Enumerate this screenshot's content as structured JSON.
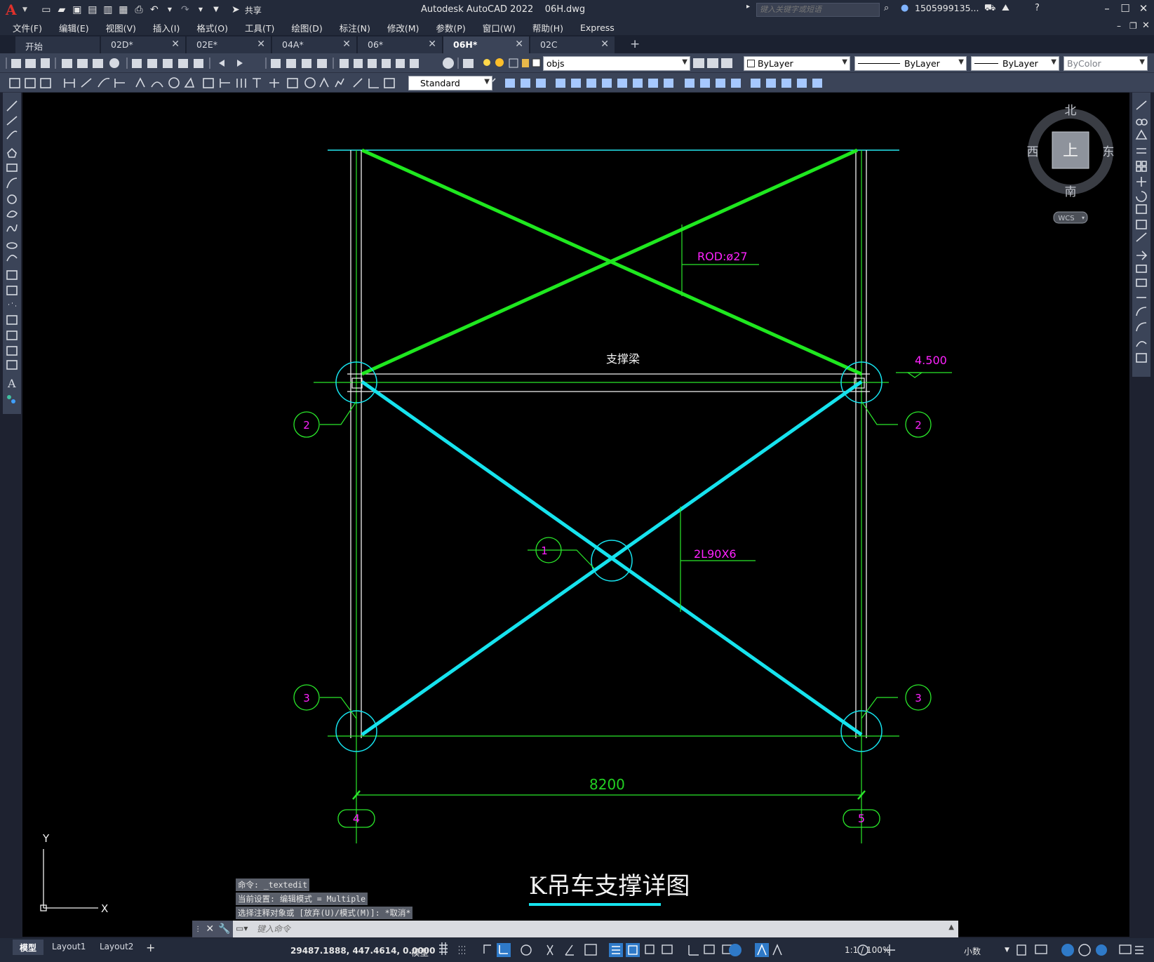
{
  "window": {
    "app_title": "Autodesk AutoCAD 2022",
    "file_name": "06H.dwg",
    "search_placeholder": "键入关键字或短语",
    "user": "1505999135...",
    "share_label": "共享"
  },
  "menu": [
    "文件(F)",
    "编辑(E)",
    "视图(V)",
    "插入(I)",
    "格式(O)",
    "工具(T)",
    "绘图(D)",
    "标注(N)",
    "修改(M)",
    "参数(P)",
    "窗口(W)",
    "帮助(H)",
    "Express"
  ],
  "tabs": [
    {
      "label": "开始",
      "closable": false,
      "active": false
    },
    {
      "label": "02D*",
      "closable": true,
      "active": false
    },
    {
      "label": "02E*",
      "closable": true,
      "active": false
    },
    {
      "label": "04A*",
      "closable": true,
      "active": false
    },
    {
      "label": "06*",
      "closable": true,
      "active": false
    },
    {
      "label": "06H*",
      "closable": true,
      "active": true
    },
    {
      "label": "02C",
      "closable": true,
      "active": false
    }
  ],
  "toolbar": {
    "layer": "objs",
    "color": "ByLayer",
    "linetype": "ByLayer",
    "lineweight": "ByLayer",
    "plotstyle": "ByColor",
    "dimstyle": "Standard"
  },
  "viewcube": {
    "north": "北",
    "south": "南",
    "east": "东",
    "west": "西",
    "top": "上",
    "wcs": "WCS"
  },
  "ucs": {
    "x": "X",
    "y": "Y"
  },
  "drawing": {
    "rod_label": "ROD:ø27",
    "beam_label": "支撑梁",
    "elevation": "4.500",
    "angle_label": "2L90X6",
    "dimension": "8200",
    "title": "K吊车支撑详图",
    "detail_marker_1": "1",
    "detail_marker_2_left": "2",
    "detail_marker_2_right": "2",
    "detail_marker_3_left": "3",
    "detail_marker_3_right": "3",
    "grid_4": "4",
    "grid_5": "5"
  },
  "command": {
    "history": [
      "命令: _textedit",
      "当前设置: 编辑模式 = Multiple",
      "选择注释对象或 [放弃(U)/模式(M)]: *取消*"
    ],
    "placeholder": "键入命令"
  },
  "status": {
    "layouts": [
      "模型",
      "Layout1",
      "Layout2"
    ],
    "coords": "29487.1888, 447.4614, 0.0000",
    "space": "模型",
    "scale": "1:1 / 100%",
    "units": "小数"
  },
  "colors": {
    "green_brace": "#1fe81f",
    "cyan_brace": "#16e3ee",
    "magenta_text": "#ff22ff",
    "dim_green": "#22d022",
    "canvas": "#000000"
  }
}
